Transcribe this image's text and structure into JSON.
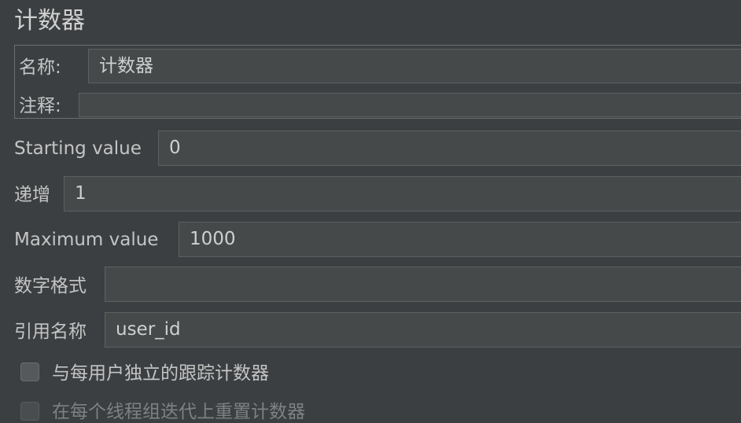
{
  "panel": {
    "title": "计数器"
  },
  "name_comment_group": {
    "name_label": "名称:",
    "name_value": "计数器",
    "comment_label": "注释:",
    "comment_value": ""
  },
  "fields": {
    "start_label": "Starting value",
    "start_value": "0",
    "increment_label": "递增",
    "increment_value": "1",
    "max_label": "Maximum value",
    "max_value": "1000",
    "format_label": "数字格式",
    "format_value": "",
    "refname_label": "引用名称",
    "refname_value": "user_id"
  },
  "options": {
    "per_user_label": "与每用户独立的跟踪计数器",
    "per_user_checked": false,
    "reset_label": "在每个线程组迭代上重置计数器",
    "reset_checked": false
  }
}
